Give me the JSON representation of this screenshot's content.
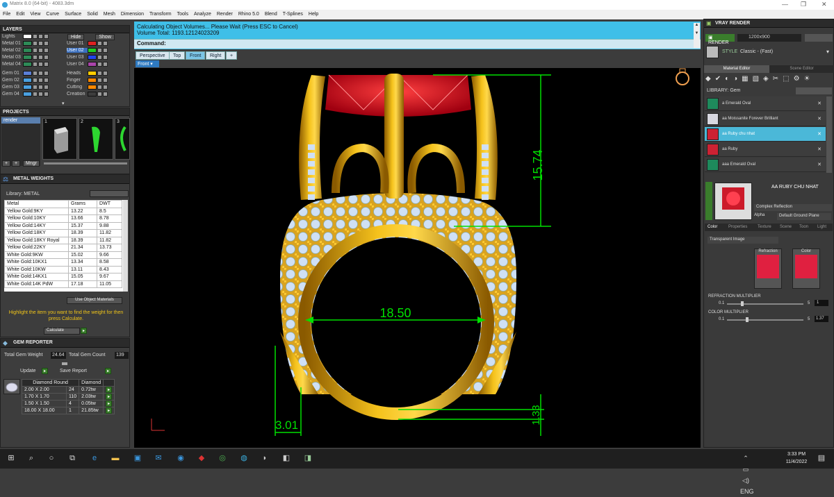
{
  "window": {
    "title": "Matrix 8.0 (64-bit) - 4083.3dm",
    "controls": [
      "—",
      "❐",
      "✕"
    ]
  },
  "menu": [
    "File",
    "Edit",
    "View",
    "Curve",
    "Surface",
    "Solid",
    "Mesh",
    "Dimension",
    "Transform",
    "Tools",
    "Analyze",
    "Render",
    "Rhino 5.0",
    "Blend",
    "T-Splines",
    "Help"
  ],
  "layers": {
    "title": "LAYERS",
    "left": [
      "Lights",
      "Metal 01",
      "Metal 02",
      "Metal 03",
      "Metal 04",
      "Gem 01",
      "Gem 02",
      "Gem 03",
      "Gem 04"
    ],
    "right": [
      "Hide",
      "User 01",
      "User 02",
      "User 03",
      "User 04",
      "Heads",
      "Finger",
      "Cutting",
      "Creation"
    ],
    "show": "Show",
    "left_colors": [
      "#ffffff",
      "#2e8b57",
      "#2e8b57",
      "#2e8b57",
      "#2e8b57",
      "#5b7fd6",
      "#4aa0e0",
      "#4aa0e0",
      "#4aa0e0"
    ],
    "right_colors": [
      "#dd2222",
      "#22cc22",
      "#2244ee",
      "#aa44aa",
      "#ffcc00",
      "#ff8800",
      "#ff8800"
    ]
  },
  "projects": {
    "title": "PROJECTS",
    "item": "render",
    "slots": [
      "1",
      "2",
      "3"
    ],
    "mngr": "Mngr"
  },
  "metal_weights": {
    "title": "METAL WEIGHTS",
    "library": "Library: METAL",
    "headers": [
      "Metal",
      "Grams",
      "DWT"
    ],
    "rows": [
      [
        "Yellow Gold:9KY",
        "13.22",
        "8.5"
      ],
      [
        "Yellow Gold:10KY",
        "13.66",
        "8.78"
      ],
      [
        "Yellow Gold:14KY",
        "15.37",
        "9.88"
      ],
      [
        "Yellow Gold:18KY",
        "18.39",
        "11.82"
      ],
      [
        "Yellow Gold:18KY Royal",
        "18.39",
        "11.82"
      ],
      [
        "Yellow Gold:22KY",
        "21.34",
        "13.73"
      ],
      [
        "White Gold:9KW",
        "15.02",
        "9.66"
      ],
      [
        "White Gold:10KX1",
        "13.34",
        "8.58"
      ],
      [
        "White Gold:10KW",
        "13.11",
        "8.43"
      ],
      [
        "White Gold:14KX1",
        "15.05",
        "9.67"
      ],
      [
        "White Gold:14K PdW",
        "17.18",
        "11.05"
      ]
    ],
    "use_object": "Use Object Materials",
    "hint": "Highlight the item you want to find the weight for then press Calculate.",
    "calculate": "Calculate"
  },
  "gem_reporter": {
    "title": "GEM REPORTER",
    "total_weight_label": "Total Gem Weight",
    "total_weight": "24.64",
    "total_count_label": "Total Gem Count",
    "total_count": "139",
    "update": "Update",
    "save_report": "Save Report",
    "col1": "Diamond Round",
    "col2": "Diamond",
    "rows": [
      [
        "2.00 X 2.00",
        "24",
        "0.72tw"
      ],
      [
        "1.70 X 1.70",
        "110",
        "2.03tw"
      ],
      [
        "1.50 X 1.50",
        "4",
        "0.05tw"
      ],
      [
        "18.00 X 18.00",
        "1",
        "21.85tw"
      ]
    ]
  },
  "command": {
    "line1": "Calculating Object Volumes... Please Wait (Press ESC to Cancel)",
    "line2": "Volume Total: 1193.12124023209",
    "label": "Command:"
  },
  "viewport": {
    "tabs": [
      "Perspective",
      "Top",
      "Front",
      "Right",
      "+"
    ],
    "active": "Front",
    "name": "Front"
  },
  "dimensions": {
    "height": "15.74",
    "width": "18.50",
    "band": "3.01",
    "base": "1.33"
  },
  "vray": {
    "title": "VRAY RENDER",
    "render": "RENDER",
    "resolution": "1200x900",
    "style_label": "STYLE",
    "style": "Classic - (Fast)",
    "tabs": [
      "Material Editor",
      "Scene Editor"
    ],
    "library": "LIBRARY: Gem",
    "materials": [
      "a Emerald Oval",
      "aa Moissanite Forever Brilliant",
      "aa Ruby chu nhat",
      "aa Ruby",
      "aaa Emerald Oval"
    ],
    "material_colors": [
      "#1e8a5c",
      "#d8d8e0",
      "#cc2233",
      "#cc2233",
      "#1e8a5c"
    ],
    "selected": "AA RUBY CHU NHAT",
    "complex": "Complex Reflection",
    "alpha": "Alpha",
    "ground": "Default Ground Plane",
    "subtabs": [
      "Color",
      "Properties",
      "Texture",
      "Scene",
      "Toon",
      "Light"
    ],
    "image_type": "Transparent Image",
    "refraction": "Refraction",
    "color": "Color",
    "refraction_multiplier": "REFRACTION MULTIPLIER",
    "refraction_min": "0.1",
    "refraction_max": "5",
    "refraction_value": "1",
    "color_multiplier": "COLOR MULTIPLIER",
    "color_min": "0.1",
    "color_max": "5",
    "color_value": "1.37"
  },
  "taskbar": {
    "time": "3:33 PM",
    "date": "11/4/2022"
  }
}
